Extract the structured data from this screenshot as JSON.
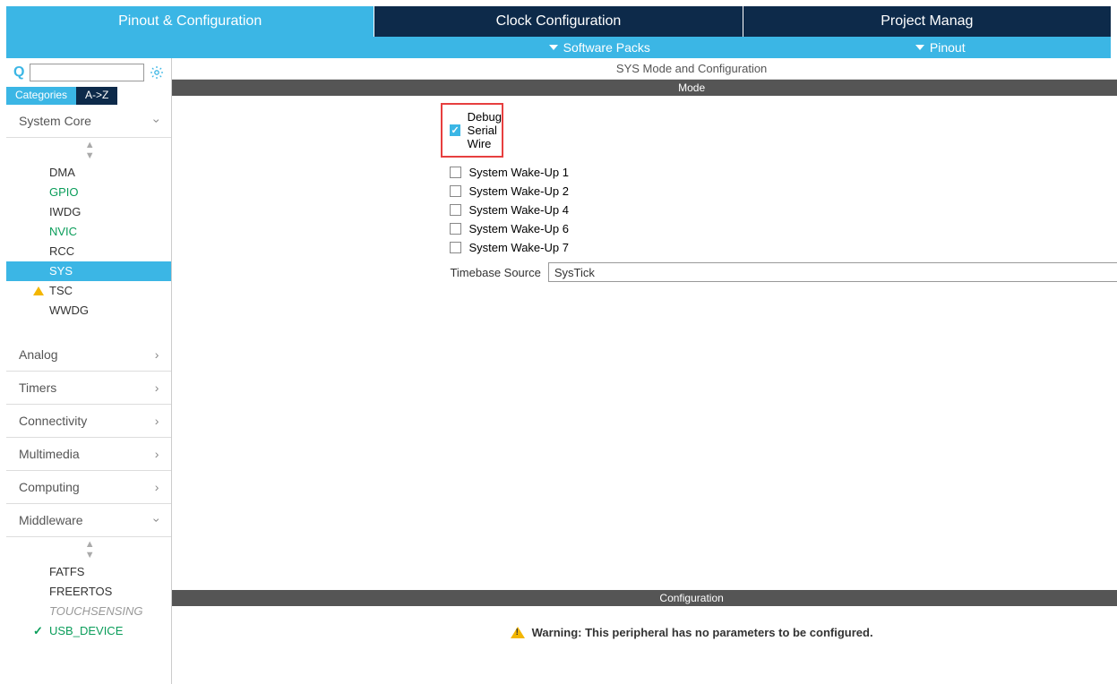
{
  "tabs": {
    "pinout": "Pinout & Configuration",
    "clock": "Clock Configuration",
    "project": "Project Manag"
  },
  "subbar": {
    "software_packs": "Software Packs",
    "pinout": "Pinout"
  },
  "search": {
    "value": ""
  },
  "sort_tabs": {
    "categories": "Categories",
    "az": "A->Z"
  },
  "sidebar": {
    "system_core": {
      "label": "System Core"
    },
    "items": {
      "dma": "DMA",
      "gpio": "GPIO",
      "iwdg": "IWDG",
      "nvic": "NVIC",
      "rcc": "RCC",
      "sys": "SYS",
      "tsc": "TSC",
      "wwdg": "WWDG"
    },
    "analog": "Analog",
    "timers": "Timers",
    "connectivity": "Connectivity",
    "multimedia": "Multimedia",
    "computing": "Computing",
    "middleware": "Middleware",
    "mw_items": {
      "fatfs": "FATFS",
      "freertos": "FREERTOS",
      "touchsensing": "TOUCHSENSING",
      "usb_device": "USB_DEVICE"
    }
  },
  "content": {
    "title": "SYS Mode and Configuration",
    "mode_label": "Mode",
    "config_label": "Configuration",
    "options": {
      "debug_serial_wire": "Debug Serial Wire",
      "wakeup1": "System Wake-Up 1",
      "wakeup2": "System Wake-Up 2",
      "wakeup4": "System Wake-Up 4",
      "wakeup6": "System Wake-Up 6",
      "wakeup7": "System Wake-Up 7"
    },
    "timebase_label": "Timebase Source",
    "timebase_value": "SysTick",
    "warning": "Warning: This peripheral has no parameters to be configured."
  }
}
